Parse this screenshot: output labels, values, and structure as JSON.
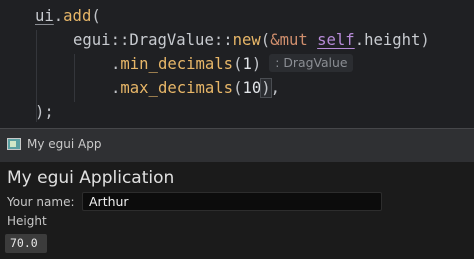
{
  "code": {
    "line1": {
      "recv": "ui",
      "dot": ".",
      "fn": "add",
      "open": "("
    },
    "line2": {
      "type": "egui",
      "sep1": "::",
      "type2": "DragValue",
      "sep2": "::",
      "fn": "new",
      "open": "(",
      "amp": "&",
      "kw": "mut",
      "self": "self",
      "field": ".height",
      "close": ")"
    },
    "line3": {
      "dot": ".",
      "fn": "min_decimals",
      "open": "(",
      "num": "1",
      "close": ")",
      "hint": ": DragValue"
    },
    "line4": {
      "dot": ".",
      "fn": "max_decimals",
      "open": "(",
      "num": "10",
      "close": ")",
      "comma": ","
    },
    "line5": {
      "text": ");"
    }
  },
  "window": {
    "title": "My egui App",
    "icon": "egui-app-icon"
  },
  "app": {
    "heading": "My egui Application",
    "name_label": "Your name:",
    "name_value": "Arthur",
    "height_label": "Height",
    "height_value": "70.0"
  }
}
